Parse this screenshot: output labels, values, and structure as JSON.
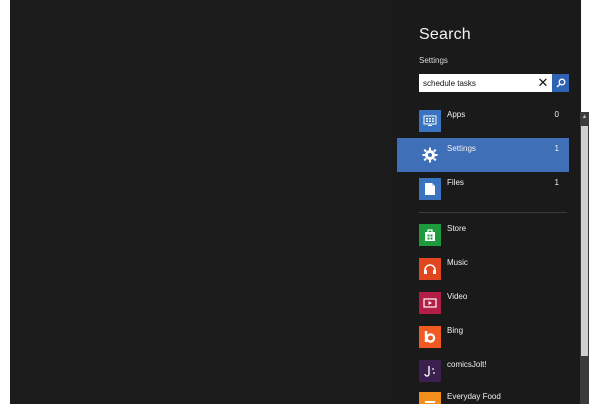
{
  "search_pane": {
    "title": "Search",
    "scope": "Settings",
    "query": "schedule tasks",
    "clear_icon": "close-icon",
    "search_icon": "magnifier-icon"
  },
  "categories": [
    {
      "label": "Apps",
      "count": "0",
      "icon": "apps-icon",
      "tile_color": "#3a74c0",
      "selected": false
    },
    {
      "label": "Settings",
      "count": "1",
      "icon": "gear-icon",
      "tile_color": "#3f6fb7",
      "selected": true
    },
    {
      "label": "Files",
      "count": "1",
      "icon": "file-icon",
      "tile_color": "#3a74c0",
      "selected": false
    }
  ],
  "apps": [
    {
      "label": "Store",
      "icon": "store-icon",
      "tile_color": "#1e9a3e"
    },
    {
      "label": "Music",
      "icon": "headphones-icon",
      "tile_color": "#e2461f"
    },
    {
      "label": "Video",
      "icon": "video-icon",
      "tile_color": "#b21e45"
    },
    {
      "label": "Bing",
      "icon": "bing-icon",
      "tile_color": "#f05a22"
    },
    {
      "label": "comicsJolt!",
      "icon": "comicsjolt-icon",
      "tile_color": "#3b1f4f"
    },
    {
      "label": "Everyday Food",
      "icon": "everyday-food-icon",
      "tile_color": "#f18e1c"
    }
  ]
}
